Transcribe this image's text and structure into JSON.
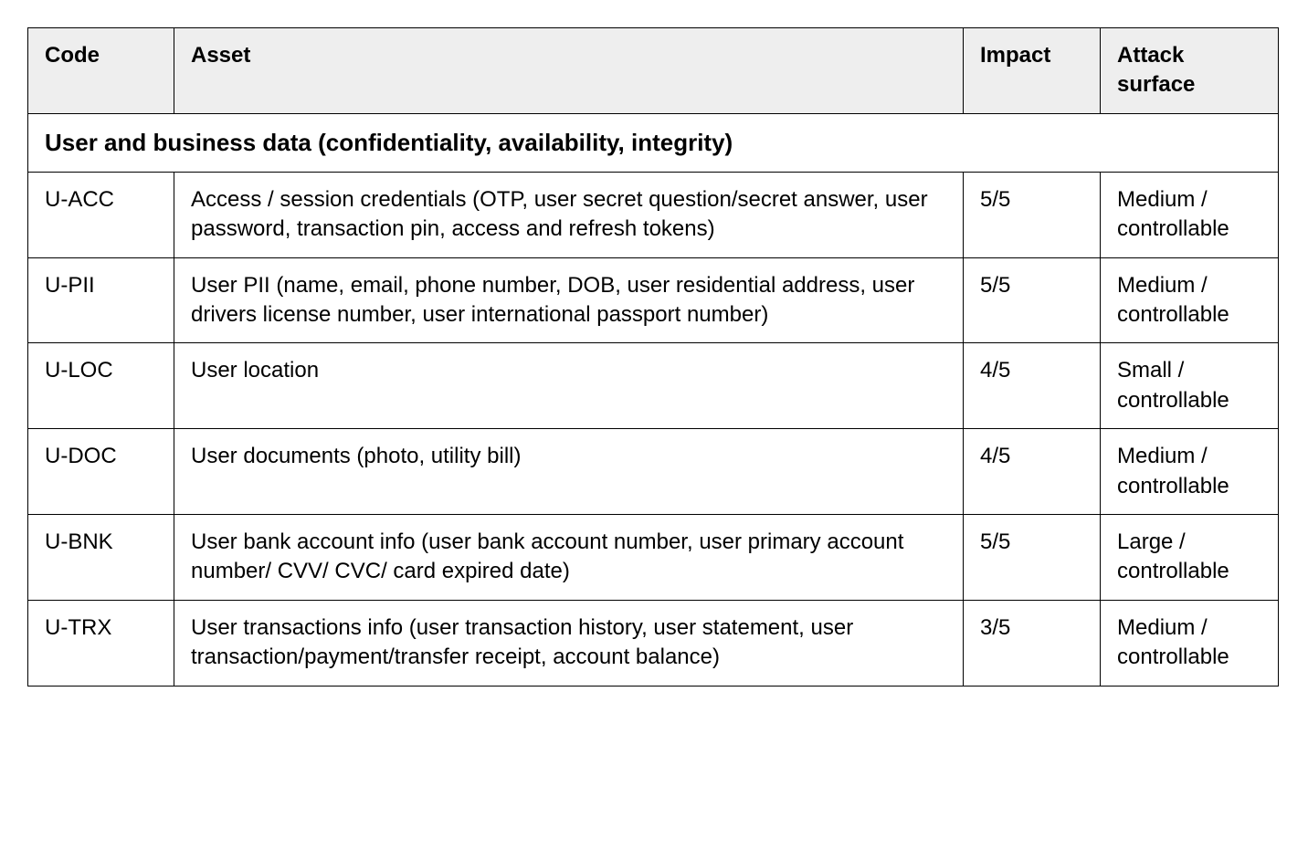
{
  "headers": {
    "code": "Code",
    "asset": "Asset",
    "impact": "Impact",
    "attack_surface": "Attack surface"
  },
  "section_title": "User and business data (confidentiality, availability, integrity)",
  "rows": [
    {
      "code": "U-ACC",
      "asset": "Access / session credentials\n(OTP, user secret question/secret answer, user password, transaction pin, access and refresh tokens)",
      "impact": "5/5",
      "attack_surface": "Medium / controllable"
    },
    {
      "code": "U-PII",
      "asset": "User PII (name, email, phone number, DOB, user residential address, user drivers license number, user international passport number)",
      "impact": "5/5",
      "attack_surface": "Medium / controllable"
    },
    {
      "code": "U-LOC",
      "asset": "User location",
      "impact": "4/5",
      "attack_surface": "Small / controllable"
    },
    {
      "code": "U-DOC",
      "asset": "User documents (photo, utility bill)",
      "impact": "4/5",
      "attack_surface": "Medium / controllable"
    },
    {
      "code": "U-BNK",
      "asset": "User bank account info (user bank account number, user primary account number/ CVV/ CVC/ card expired date)",
      "impact": "5/5",
      "attack_surface": "Large / controllable"
    },
    {
      "code": "U-TRX",
      "asset": "User transactions info (user transaction history, user statement, user transaction/payment/transfer receipt, account balance)",
      "impact": "3/5",
      "attack_surface": "Medium / controllable"
    }
  ]
}
